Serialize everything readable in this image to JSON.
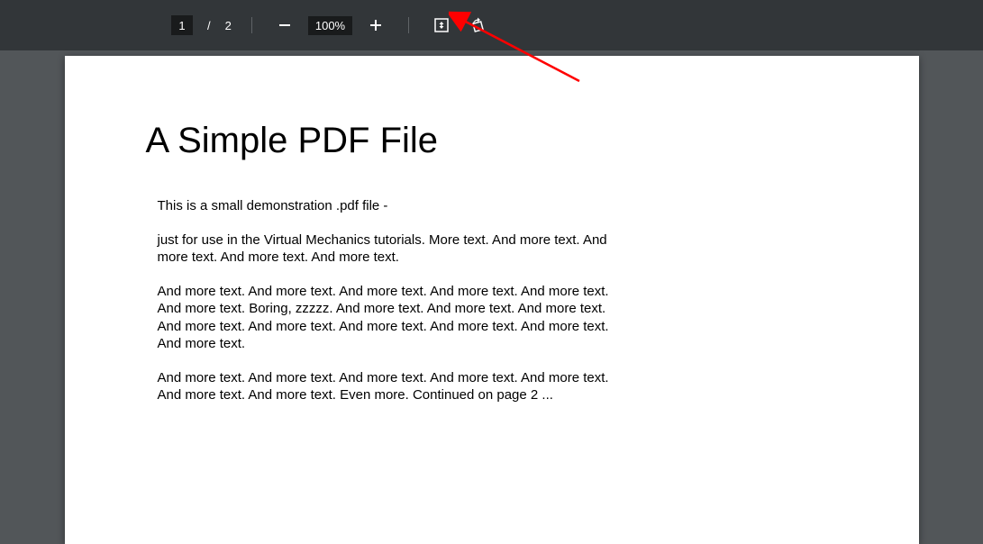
{
  "toolbar": {
    "current_page": "1",
    "page_separator": "/",
    "total_pages": "2",
    "zoom_level": "100%"
  },
  "document": {
    "title": "A Simple PDF File",
    "paragraphs": [
      "This is a small demonstration .pdf file -",
      "just for use in the Virtual Mechanics tutorials. More text. And more text. And more text. And more text. And more text.",
      "And more text. And more text. And more text. And more text. And more text. And more text. Boring, zzzzz. And more text. And more text. And more text. And more text. And more text. And more text. And more text. And more text. And more text.",
      "And more text. And more text. And more text. And more text. And more text. And more text. And more text. Even more. Continued on page 2 ..."
    ]
  }
}
